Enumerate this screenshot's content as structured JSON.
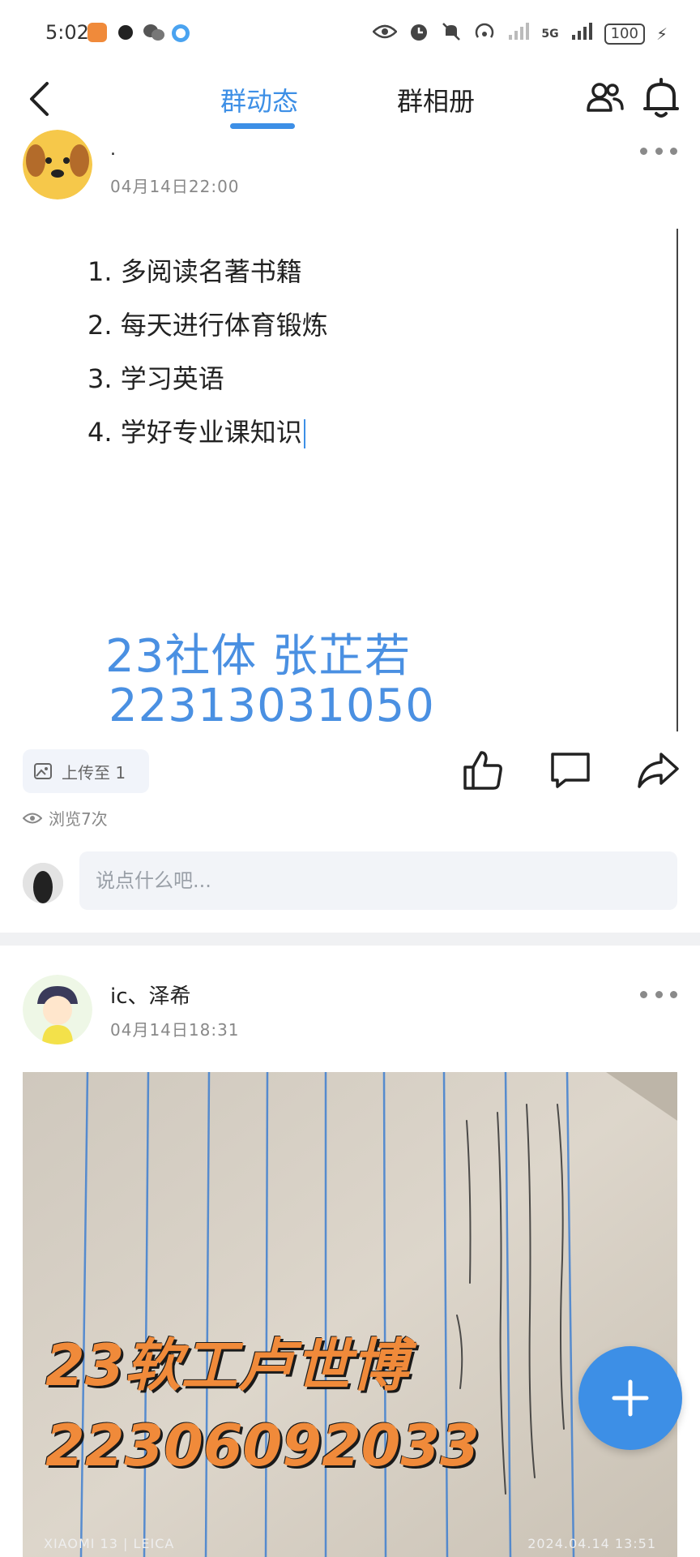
{
  "status_bar": {
    "time": "5:02",
    "network": "5G",
    "battery": "100"
  },
  "header": {
    "tabs": [
      {
        "label": "群动态",
        "active": true
      },
      {
        "label": "群相册",
        "active": false
      }
    ]
  },
  "posts": [
    {
      "username": ".",
      "time": "04月14日22:00",
      "image_text": {
        "list": [
          "1. 多阅读名著书籍",
          "2. 每天进行体育锻炼",
          "3. 学习英语",
          "4. 学好专业课知识"
        ],
        "name_line": "23社体 张芷若",
        "id_line": "22313031050"
      },
      "upload_label": "上传至 1",
      "views": "浏览7次",
      "comment_placeholder": "说点什么吧..."
    },
    {
      "username": "ic、泽希",
      "time": "04月14日18:31",
      "image_text": {
        "name_line": "23软工卢世博",
        "id_line": "22306092033",
        "camera_caption": "XIAOMI 13 | LEICA",
        "photo_date": "2024.04.14  13:51"
      }
    }
  ],
  "icons": {
    "back": "chevron-left-icon",
    "members": "group-members-icon",
    "notifications": "bell-icon",
    "more": "more-dots-icon",
    "like": "thumbs-up-icon",
    "comment": "comment-icon",
    "share": "share-arrow-icon",
    "fab": "plus-icon"
  },
  "colors": {
    "accent": "#3d8fe6",
    "name_overlay_blue": "#4a90e2",
    "name_overlay_orange": "#f08a3a"
  }
}
